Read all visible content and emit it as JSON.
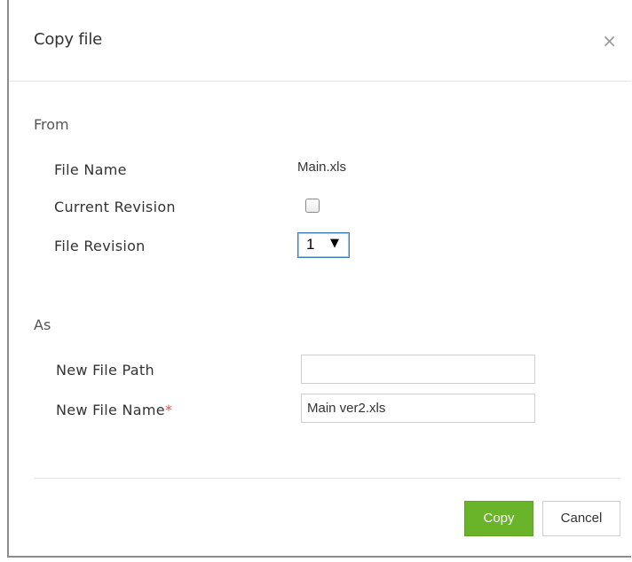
{
  "dialog": {
    "title": "Copy file",
    "close_glyph": "×"
  },
  "from_section": {
    "title": "From",
    "file_name_label": "File Name",
    "file_name_value": "Main.xls",
    "current_revision_label": "Current Revision",
    "current_revision_checked": false,
    "file_revision_label": "File Revision",
    "file_revision_value": "1",
    "dropdown_icon": "▼"
  },
  "as_section": {
    "title": "As",
    "new_file_path_label": "New File Path",
    "new_file_path_value": "",
    "new_file_name_label": "New File Name",
    "required_marker": "*",
    "new_file_name_value": "Main ver2.xls"
  },
  "footer": {
    "copy_label": "Copy",
    "cancel_label": "Cancel"
  },
  "colors": {
    "accent": "#6ab42a",
    "required": "#d9534f"
  }
}
